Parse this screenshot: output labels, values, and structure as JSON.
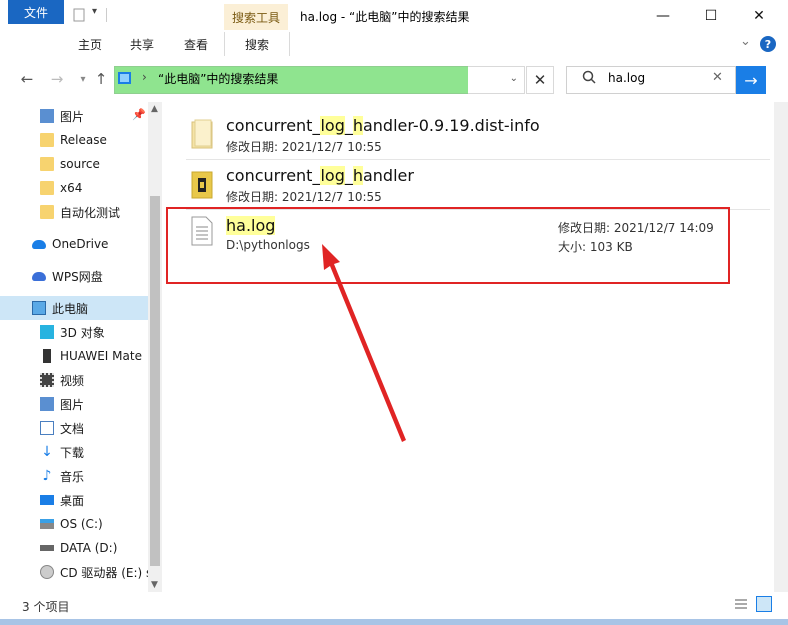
{
  "window": {
    "title": "ha.log - “此电脑”中的搜索结果",
    "context_tab": "搜索工具",
    "controls": {
      "minimize": "—",
      "maximize": "☐",
      "close": "✕"
    }
  },
  "ribbon": {
    "tabs": [
      "文件",
      "主页",
      "共享",
      "查看",
      "搜索"
    ],
    "collapse": "⌄",
    "help": "?"
  },
  "address": {
    "path": "“此电脑”中的搜索结果",
    "separator": "›",
    "close": "✕"
  },
  "search": {
    "value": "ha.log",
    "clear": "✕",
    "go": "→"
  },
  "nav": {
    "items": [
      {
        "label": "图片"
      },
      {
        "label": "Release"
      },
      {
        "label": "source"
      },
      {
        "label": "x64"
      },
      {
        "label": "自动化测试"
      },
      {
        "label": "OneDrive"
      },
      {
        "label": "WPS网盘"
      },
      {
        "label": "此电脑"
      },
      {
        "label": "3D 对象"
      },
      {
        "label": "HUAWEI Mate"
      },
      {
        "label": "视频"
      },
      {
        "label": "图片"
      },
      {
        "label": "文档"
      },
      {
        "label": "下载"
      },
      {
        "label": "音乐"
      },
      {
        "label": "桌面"
      },
      {
        "label": "OS (C:)"
      },
      {
        "label": "DATA (D:)"
      },
      {
        "label": "CD 驱动器 (E:) s"
      }
    ]
  },
  "results": [
    {
      "name_pre": "concurrent_",
      "name_hl1": "log",
      "name_mid": "_",
      "name_hl2": "h",
      "name_post": "andler-0.9.19.dist-info",
      "date_label": "修改日期:",
      "date": "2021/12/7 10:55"
    },
    {
      "name_pre": "concurrent_",
      "name_hl1": "log",
      "name_mid": "_",
      "name_hl2": "h",
      "name_post": "andler",
      "date_label": "修改日期:",
      "date": "2021/12/7 10:55"
    },
    {
      "name": "ha.log",
      "path": "D:\\pythonlogs",
      "date_label": "修改日期:",
      "date": "2021/12/7 14:09",
      "size_label": "大小:",
      "size": "103 KB"
    }
  ],
  "status": {
    "count": "3 个项目"
  },
  "colors": {
    "accent": "#1a67c2",
    "highlight_box": "#e02424",
    "address_bg": "#8fe48f"
  }
}
